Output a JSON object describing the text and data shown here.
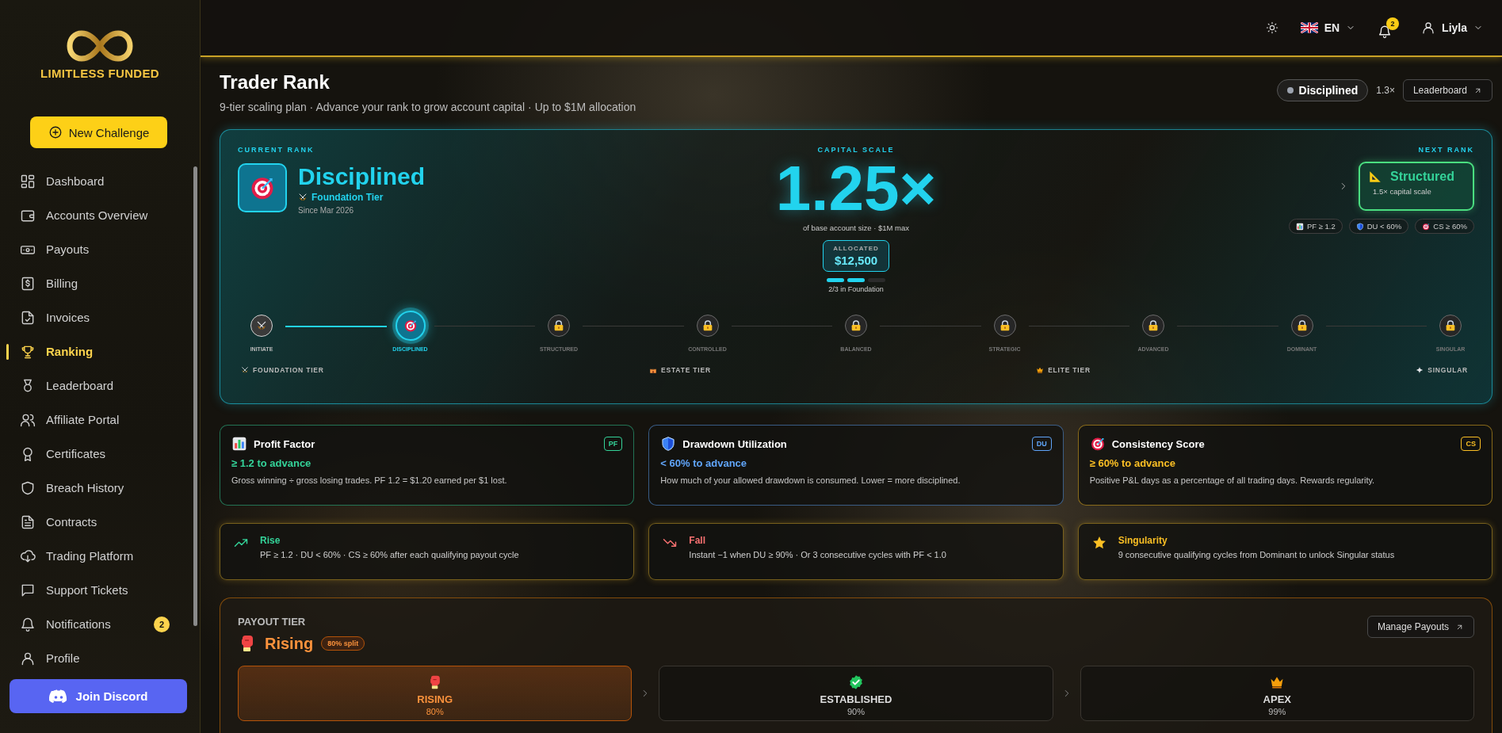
{
  "brand": {
    "name": "LIMITLESS FUNDED"
  },
  "sidebar": {
    "new_challenge": "New Challenge",
    "discord": "Join Discord",
    "items": [
      {
        "label": "Dashboard",
        "selected": false
      },
      {
        "label": "Accounts Overview",
        "selected": false
      },
      {
        "label": "Payouts",
        "selected": false
      },
      {
        "label": "Billing",
        "selected": false
      },
      {
        "label": "Invoices",
        "selected": false
      },
      {
        "label": "Ranking",
        "selected": true
      },
      {
        "label": "Leaderboard",
        "selected": false
      },
      {
        "label": "Affiliate Portal",
        "selected": false
      },
      {
        "label": "Certificates",
        "selected": false
      },
      {
        "label": "Breach History",
        "selected": false
      },
      {
        "label": "Contracts",
        "selected": false
      },
      {
        "label": "Trading Platform",
        "selected": false
      },
      {
        "label": "Support Tickets",
        "selected": false
      },
      {
        "label": "Notifications",
        "selected": false,
        "badge": "2"
      },
      {
        "label": "Profile",
        "selected": false
      }
    ]
  },
  "header": {
    "language": "EN",
    "notification_count": "2",
    "user": "Liyla"
  },
  "page": {
    "title": "Trader Rank",
    "subtitle": "9-tier scaling plan · Advance your rank to grow account capital · Up to $1M allocation",
    "rank_pill": "Disciplined",
    "multiplier": "1.3×",
    "leaderboard_button": "Leaderboard"
  },
  "rank_card": {
    "current_label": "CURRENT RANK",
    "current_name": "Disciplined",
    "current_tier": "Foundation Tier",
    "since": "Since Mar 2026",
    "scale_label": "CAPITAL SCALE",
    "scale": "1.25×",
    "scale_note": "of base account size · $1M max",
    "allocated_label": "ALLOCATED",
    "allocated": "$12,500",
    "progress_segments": [
      {
        "filled": true
      },
      {
        "filled": true
      },
      {
        "filled": false
      }
    ],
    "progress_text": "2/3 in Foundation",
    "next_label": "NEXT RANK",
    "next_name": "Structured",
    "next_note": "1.5× capital scale",
    "requirements": [
      "PF ≥ 1.2",
      "DU < 60%",
      "CS ≥ 60%"
    ],
    "steps": [
      {
        "label": "INITIATE",
        "completed": true,
        "current": false
      },
      {
        "label": "DISCIPLINED",
        "completed": false,
        "current": true
      },
      {
        "label": "STRUCTURED",
        "completed": false,
        "current": false
      },
      {
        "label": "CONTROLLED",
        "completed": false,
        "current": false
      },
      {
        "label": "BALANCED",
        "completed": false,
        "current": false
      },
      {
        "label": "STRATEGIC",
        "completed": false,
        "current": false
      },
      {
        "label": "ADVANCED",
        "completed": false,
        "current": false
      },
      {
        "label": "DOMINANT",
        "completed": false,
        "current": false
      },
      {
        "label": "SINGULAR",
        "completed": false,
        "current": false
      }
    ],
    "tiers": [
      "FOUNDATION TIER",
      "ESTATE TIER",
      "ELITE TIER",
      "SINGULAR"
    ]
  },
  "metrics": [
    {
      "title": "Profit Factor",
      "badge": "PF",
      "target": "≥ 1.2 to advance",
      "description": "Gross winning ÷ gross losing trades. PF 1.2 = $1.20 earned per $1 lost.",
      "color": "#34d399"
    },
    {
      "title": "Drawdown Utilization",
      "badge": "DU",
      "target": "< 60% to advance",
      "description": "How much of your allowed drawdown is consumed. Lower = more disciplined.",
      "color": "#60a5fa"
    },
    {
      "title": "Consistency Score",
      "badge": "CS",
      "target": "≥ 60% to advance",
      "description": "Positive P&L days as a percentage of all trading days. Rewards regularity.",
      "color": "#fbbf24"
    }
  ],
  "rules": [
    {
      "title": "Rise",
      "text": "PF ≥ 1.2 · DU < 60% · CS ≥ 60% after each qualifying payout cycle",
      "color": "#34d399"
    },
    {
      "title": "Fall",
      "text": "Instant −1 when DU ≥ 90% · Or 3 consecutive cycles with PF < 1.0",
      "color": "#f87171"
    },
    {
      "title": "Singularity",
      "text": "9 consecutive qualifying cycles from Dominant to unlock Singular status",
      "color": "#fbbf24"
    }
  ],
  "payout": {
    "label": "PAYOUT TIER",
    "current": "Rising",
    "split": "80% split",
    "manage_button": "Manage Payouts",
    "tiers": [
      {
        "name": "RISING",
        "percent": "80%",
        "selected": true
      },
      {
        "name": "ESTABLISHED",
        "percent": "90%",
        "selected": false
      },
      {
        "name": "APEX",
        "percent": "99%",
        "selected": false
      }
    ]
  }
}
